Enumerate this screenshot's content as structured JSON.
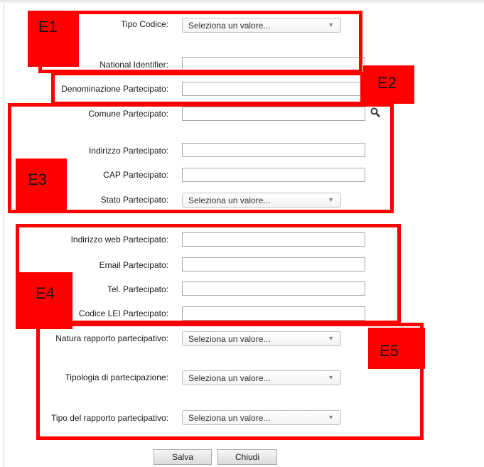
{
  "fields": {
    "tipo_codice_label": "Tipo Codice:",
    "tipo_codice_value": "Seleziona un valore...",
    "national_identifier_label": "National Identifier:",
    "national_identifier_value": "",
    "denominazione_label": "Denominazione Partecipato:",
    "denominazione_value": "",
    "comune_label": "Comune Partecipato:",
    "comune_value": "",
    "indirizzo_label": "Indirizzo Partecipato:",
    "indirizzo_value": "",
    "cap_label": "CAP Partecipato:",
    "cap_value": "",
    "stato_label": "Stato Partecipato:",
    "stato_value": "Seleziona un valore...",
    "indirizzo_web_label": "Indirizzo web Partecipato:",
    "indirizzo_web_value": "",
    "email_label": "Email Partecipato:",
    "email_value": "",
    "tel_label": "Tel. Partecipato:",
    "tel_value": "",
    "lei_label": "Codice LEI Partecipato:",
    "lei_value": "",
    "natura_label": "Natura rapporto partecipativo:",
    "natura_value": "Seleziona un valore...",
    "tipologia_label": "Tipologia di partecipazione:",
    "tipologia_value": "Seleziona un valore...",
    "tipo_rapporto_label": "Tipo del rapporto partecipativo:",
    "tipo_rapporto_value": "Seleziona un valore..."
  },
  "dropdown_caret": "▼",
  "icons": {
    "comune_search": "search-icon"
  },
  "annotations": {
    "e1": "E1",
    "e2": "E2",
    "e3": "E3",
    "e4": "E4",
    "e5": "E5"
  },
  "annotation_color": "#ff0000",
  "buttons": {
    "save": "Salva",
    "close": "Chiudi"
  }
}
